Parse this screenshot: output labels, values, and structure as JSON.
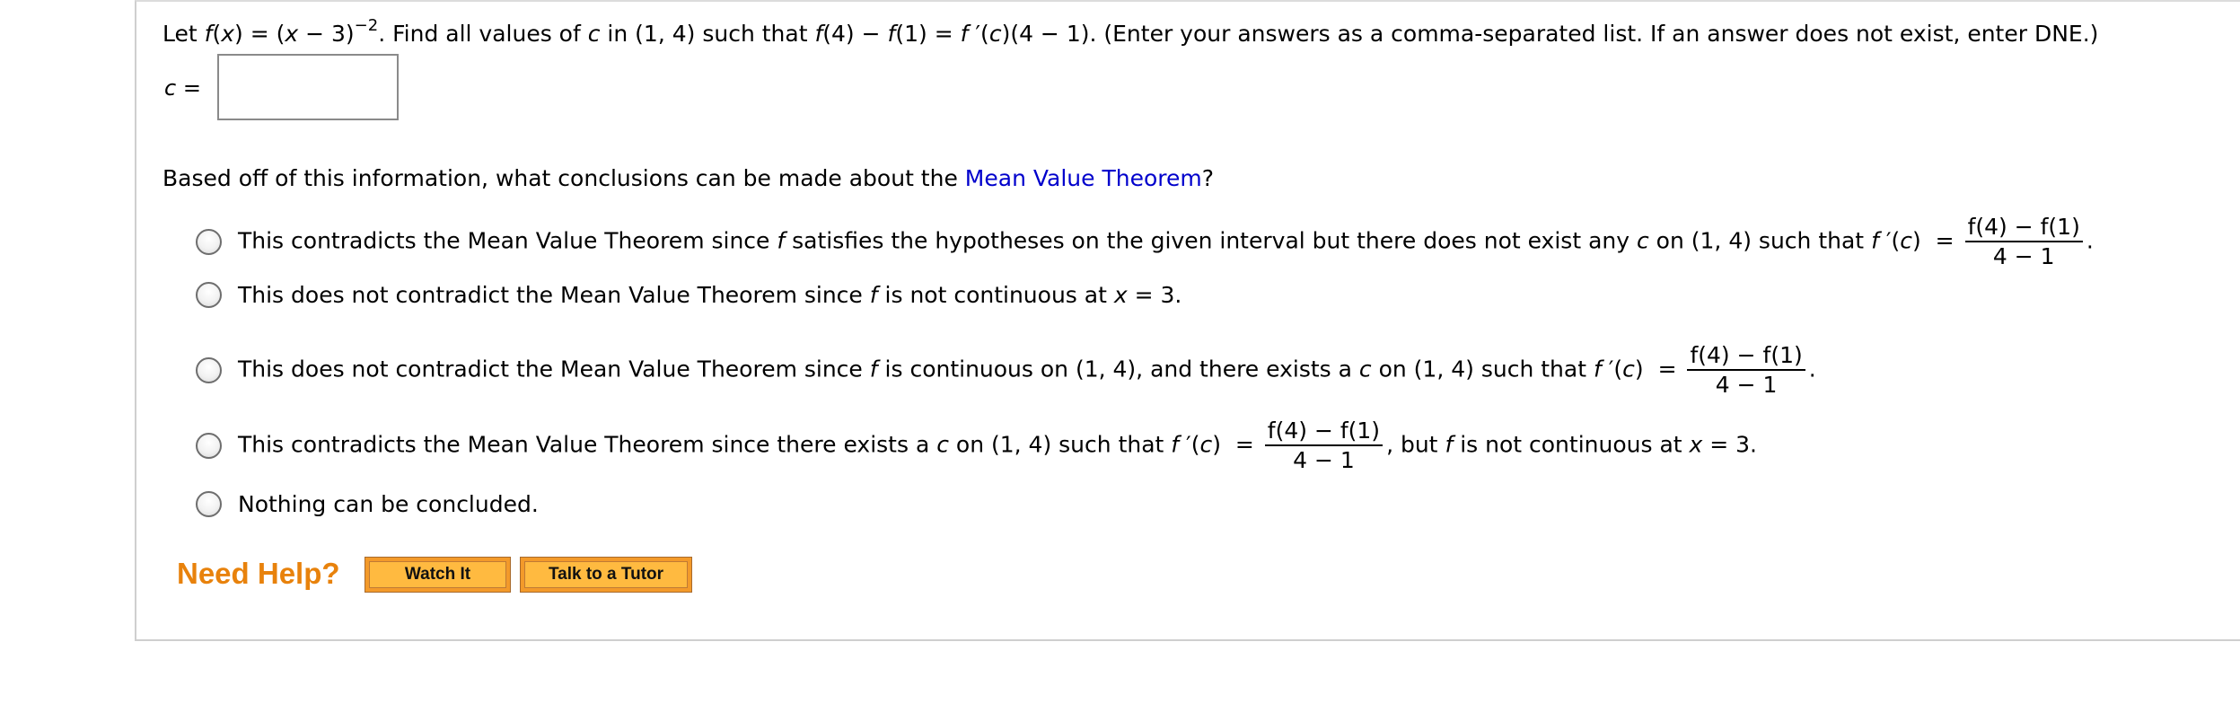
{
  "question": {
    "let": "Let ",
    "fx": "f",
    "fx_rest": "(",
    "x1": "x",
    "eq": ") = (",
    "x2": "x",
    "minus3": " − 3)",
    "exp": "−2",
    "find": ". Find all values of ",
    "c": "c",
    "in": " in (1, 4) such that  ",
    "f1": "f",
    "p1": "(4) − ",
    "f2": "f",
    "p2": "(1) = ",
    "f3": "f",
    "p3": " ′(",
    "c2": "c",
    "p4": ")(4 − 1).  (Enter your answers as a comma-separated list. If an answer does not exist, enter DNE.)"
  },
  "answer": {
    "label": "c = ",
    "value": ""
  },
  "prompt": {
    "before": "Based off of this information, what conclusions can be made about the ",
    "link": "Mean Value Theorem",
    "after": "?"
  },
  "options": [
    {
      "segments": [
        {
          "text": "This contradicts the Mean Value Theorem since "
        },
        {
          "text": "f",
          "italic": true
        },
        {
          "text": " satisfies the hypotheses on the given interval but there does not exist any "
        },
        {
          "text": "c",
          "italic": true
        },
        {
          "text": " on (1, 4) such that "
        },
        {
          "text": "f",
          "italic": true
        },
        {
          "text": " ′("
        },
        {
          "text": "c",
          "italic": true
        },
        {
          "text": ")  = "
        },
        {
          "num": "f(4) − f(1)",
          "den": "4 − 1"
        },
        {
          "text": "."
        }
      ]
    },
    {
      "segments": [
        {
          "text": "This does not contradict the Mean Value Theorem since "
        },
        {
          "text": "f",
          "italic": true
        },
        {
          "text": " is not continuous at "
        },
        {
          "text": "x",
          "italic": true
        },
        {
          "text": " = 3."
        }
      ]
    },
    {
      "segments": [
        {
          "text": "This does not contradict the Mean Value Theorem since "
        },
        {
          "text": "f",
          "italic": true
        },
        {
          "text": " is continuous on (1, 4), and there exists a "
        },
        {
          "text": "c",
          "italic": true
        },
        {
          "text": " on (1, 4) such that "
        },
        {
          "text": "f",
          "italic": true
        },
        {
          "text": " ′("
        },
        {
          "text": "c",
          "italic": true
        },
        {
          "text": ")  = "
        },
        {
          "num": "f(4) − f(1)",
          "den": "4 − 1"
        },
        {
          "text": "."
        }
      ]
    },
    {
      "segments": [
        {
          "text": "This contradicts the Mean Value Theorem since there exists a "
        },
        {
          "text": "c",
          "italic": true
        },
        {
          "text": " on (1, 4) such that "
        },
        {
          "text": "f",
          "italic": true
        },
        {
          "text": " ′("
        },
        {
          "text": "c",
          "italic": true
        },
        {
          "text": ")  = "
        },
        {
          "num": "f(4) − f(1)",
          "den": "4 − 1"
        },
        {
          "text": ", but "
        },
        {
          "text": "f",
          "italic": true
        },
        {
          "text": " is not continuous at "
        },
        {
          "text": "x",
          "italic": true
        },
        {
          "text": " = 3."
        }
      ]
    },
    {
      "segments": [
        {
          "text": "Nothing can be concluded."
        }
      ]
    }
  ],
  "help": {
    "label": "Need Help?",
    "watch": "Watch It",
    "tutor": "Talk to a Tutor"
  },
  "colors": {
    "link": "#0000cc",
    "help": "#e8820c",
    "button": "#ffba40"
  }
}
